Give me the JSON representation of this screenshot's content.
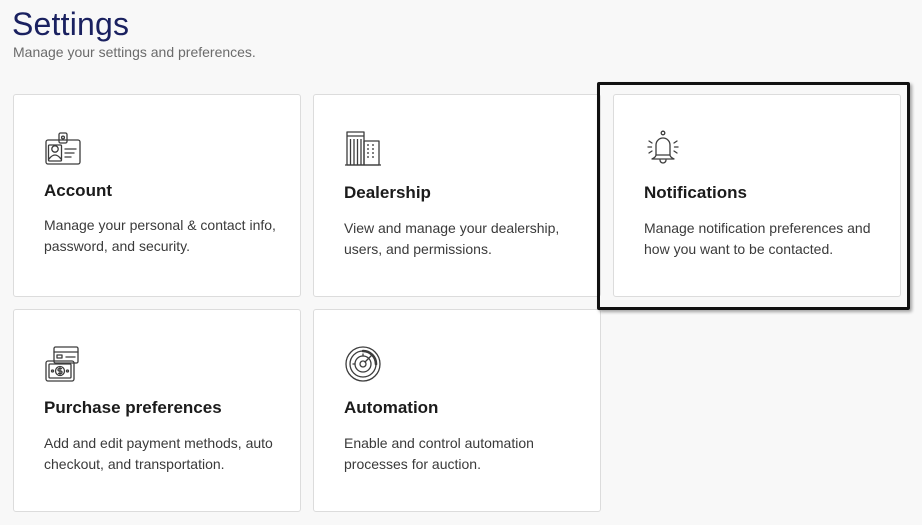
{
  "header": {
    "title": "Settings",
    "subtitle": "Manage your settings and preferences."
  },
  "cards": {
    "account": {
      "icon": "id-badge-icon",
      "title": "Account",
      "description": "Manage your personal & contact info, password, and security."
    },
    "dealership": {
      "icon": "building-icon",
      "title": "Dealership",
      "description": "View and manage your dealership, users, and permissions."
    },
    "notifications": {
      "icon": "bell-icon",
      "title": "Notifications",
      "description": "Manage notification preferences and how you want to be contacted."
    },
    "purchase": {
      "icon": "payment-card-icon",
      "title": "Purchase preferences",
      "description": "Add and edit payment methods, auto checkout, and transportation."
    },
    "automation": {
      "icon": "automation-dial-icon",
      "title": "Automation",
      "description": "Enable and control automation processes for auction."
    }
  },
  "colors": {
    "title": "#1a2160",
    "icon_stroke": "#3c3c3c",
    "highlight": "#111111"
  }
}
